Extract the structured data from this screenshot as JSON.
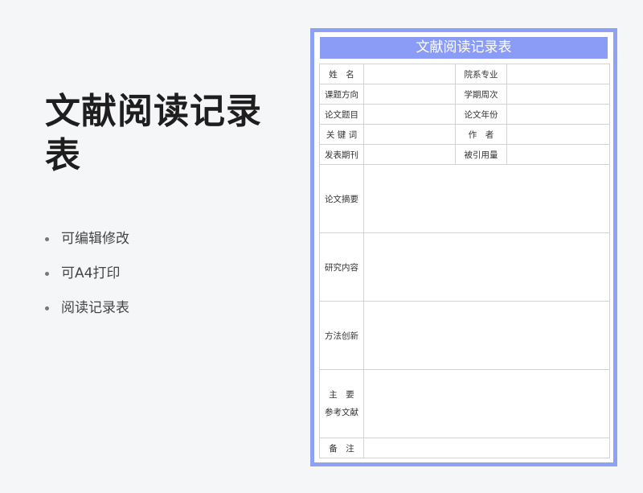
{
  "headline": "文献阅读记录表",
  "features": [
    {
      "text": "可编辑修改"
    },
    {
      "text": "可A4打印"
    },
    {
      "text": "阅读记录表"
    }
  ],
  "sheet": {
    "title": "文献阅读记录表",
    "rows_short": [
      {
        "label_left": "姓　名",
        "label_right": "院系专业"
      },
      {
        "label_left": "课题方向",
        "label_right": "学期周次"
      },
      {
        "label_left": "论文题目",
        "label_right": "论文年份"
      },
      {
        "label_left": "关 键 词",
        "label_right": "作　者"
      },
      {
        "label_left": "发表期刊",
        "label_right": "被引用量"
      }
    ],
    "rows_tall": [
      {
        "label": "论文摘要"
      },
      {
        "label": "研究内容"
      },
      {
        "label": "方法创新"
      }
    ],
    "references_label_line1": "主　要",
    "references_label_line2": "参考文献",
    "notes_label": "备　注"
  },
  "colors": {
    "accent": "#8a9cf5",
    "frame": "#8ea2f3",
    "background": "#f5f6f8"
  }
}
